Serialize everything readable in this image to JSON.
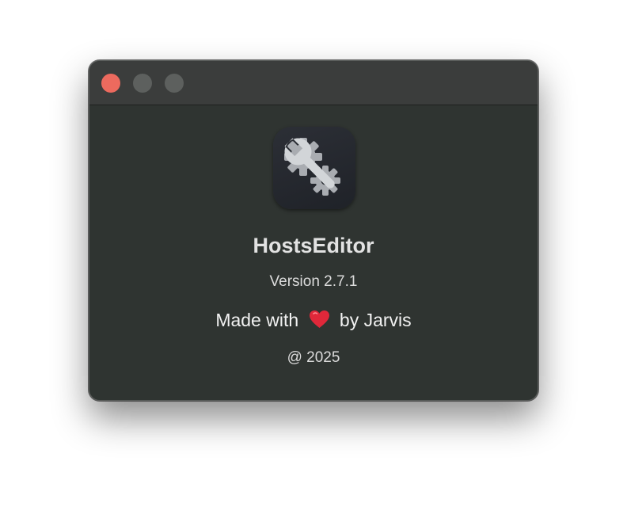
{
  "window": {
    "title_buttons": {
      "close": "close-button",
      "minimize": "minimize-button",
      "zoom": "zoom-button"
    }
  },
  "about": {
    "app_icon": "gear-wrench-icon",
    "app_name": "HostsEditor",
    "version": "Version 2.7.1",
    "made_with_prefix": "Made with",
    "made_with_icon": "heart-icon",
    "made_with_suffix": "by Jarvis",
    "copyright": "@ 2025"
  },
  "colors": {
    "close_button": "#ec6a5e",
    "inactive_button": "#5d605e",
    "window_background": "#2f3431",
    "titlebar_background": "#3b3d3c",
    "heart": "#e0283a"
  }
}
